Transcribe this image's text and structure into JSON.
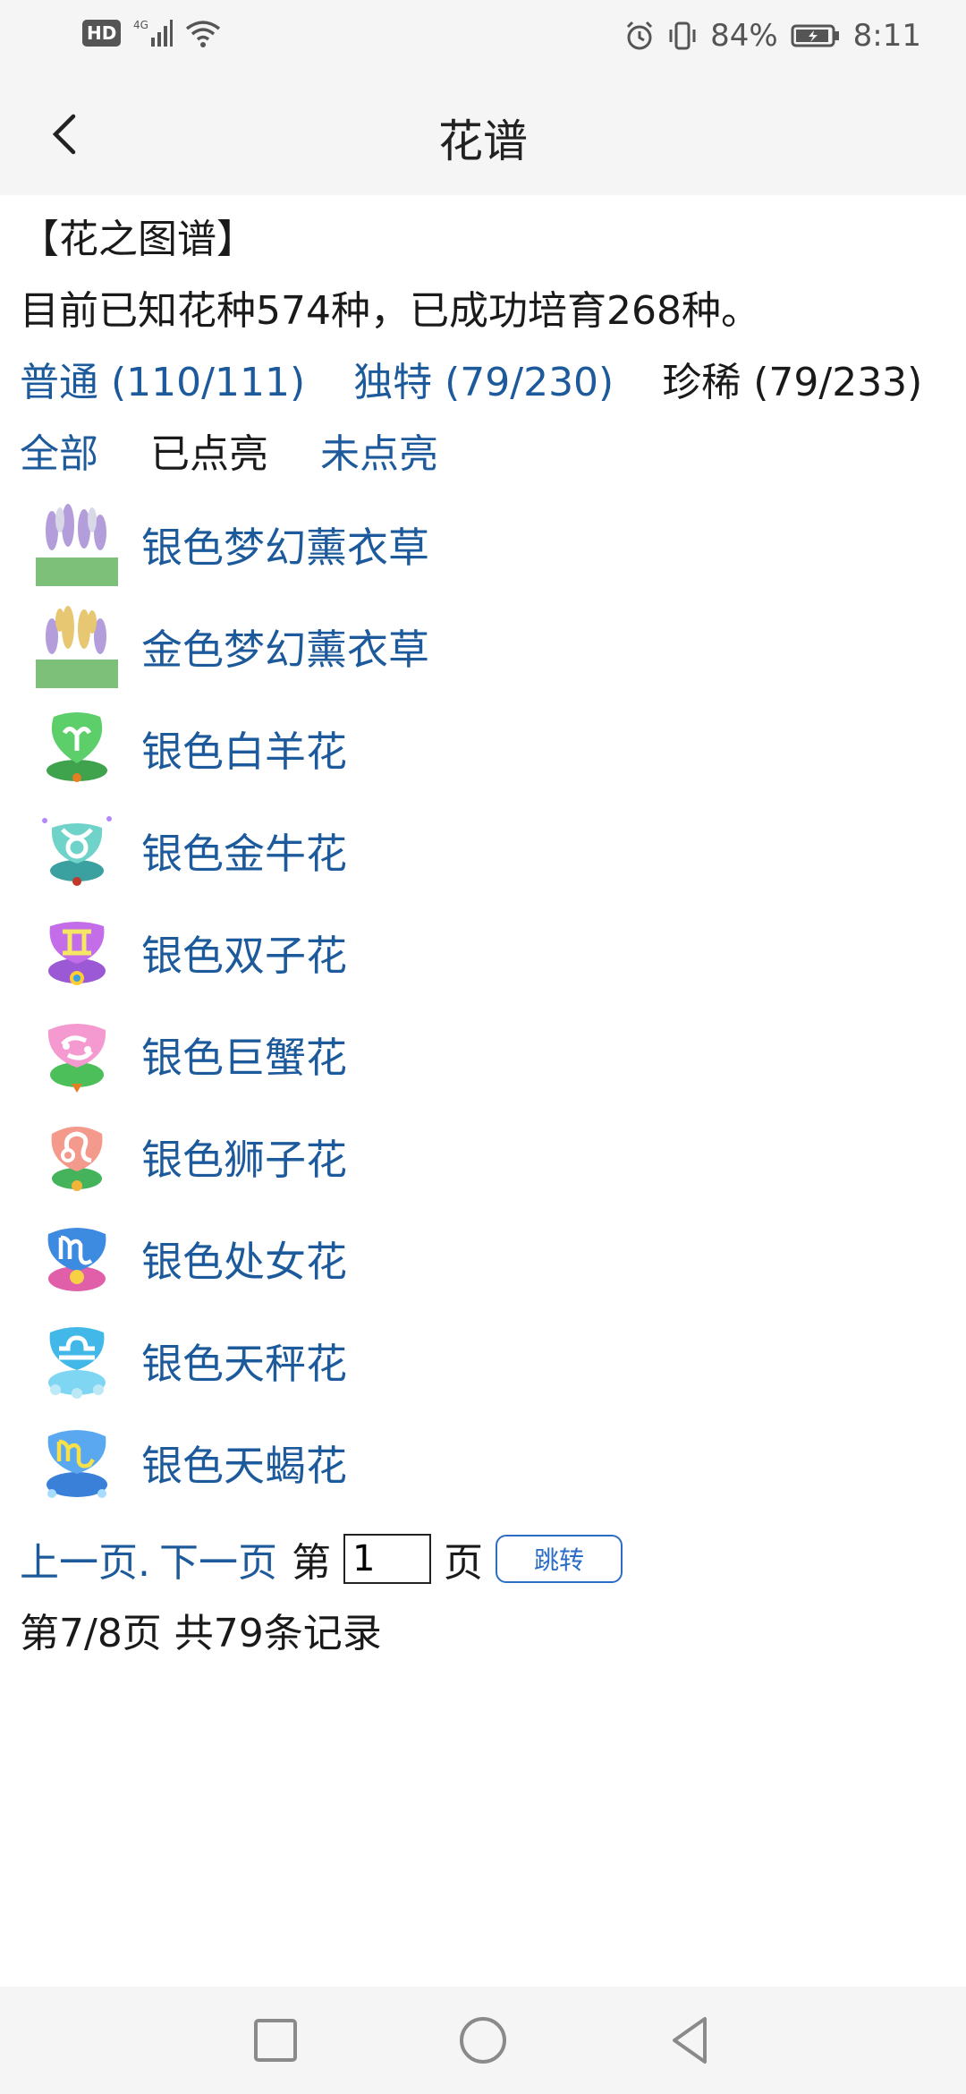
{
  "status": {
    "network": "4G",
    "battery": "84%",
    "time": "8:11",
    "hd": "HD"
  },
  "header": {
    "title": "花谱"
  },
  "intro": {
    "section_title": "【花之图谱】",
    "summary": "目前已知花种574种，已成功培育268种。"
  },
  "rarity_filters": [
    {
      "label": "普通 (110/111)",
      "color": "#1d5a9b"
    },
    {
      "label": "独特 (79/230)",
      "color": "#1d5a9b"
    },
    {
      "label": "珍稀 (79/233)",
      "color": "#1a1a1a"
    }
  ],
  "status_tabs": [
    {
      "label": "全部",
      "color": "#1d5a9b"
    },
    {
      "label": "已点亮",
      "color": "#1a1a1a"
    },
    {
      "label": "未点亮",
      "color": "#1d5a9b"
    }
  ],
  "flowers": [
    {
      "name": "银色梦幻薰衣草",
      "icon": "lavender-icon"
    },
    {
      "name": "金色梦幻薰衣草",
      "icon": "lavender-icon"
    },
    {
      "name": "银色白羊花",
      "icon": "aries-flower-icon"
    },
    {
      "name": "银色金牛花",
      "icon": "taurus-flower-icon"
    },
    {
      "name": "银色双子花",
      "icon": "gemini-flower-icon"
    },
    {
      "name": "银色巨蟹花",
      "icon": "cancer-flower-icon"
    },
    {
      "name": "银色狮子花",
      "icon": "leo-flower-icon"
    },
    {
      "name": "银色处女花",
      "icon": "virgo-flower-icon"
    },
    {
      "name": "银色天秤花",
      "icon": "libra-flower-icon"
    },
    {
      "name": "银色天蝎花",
      "icon": "scorpio-flower-icon"
    }
  ],
  "pager": {
    "prev": "上一页.",
    "next": "下一页",
    "page_prefix": "第",
    "page_value": "1",
    "page_suffix": "页",
    "jump_label": "跳转"
  },
  "page_info": "第7/8页 共79条记录"
}
